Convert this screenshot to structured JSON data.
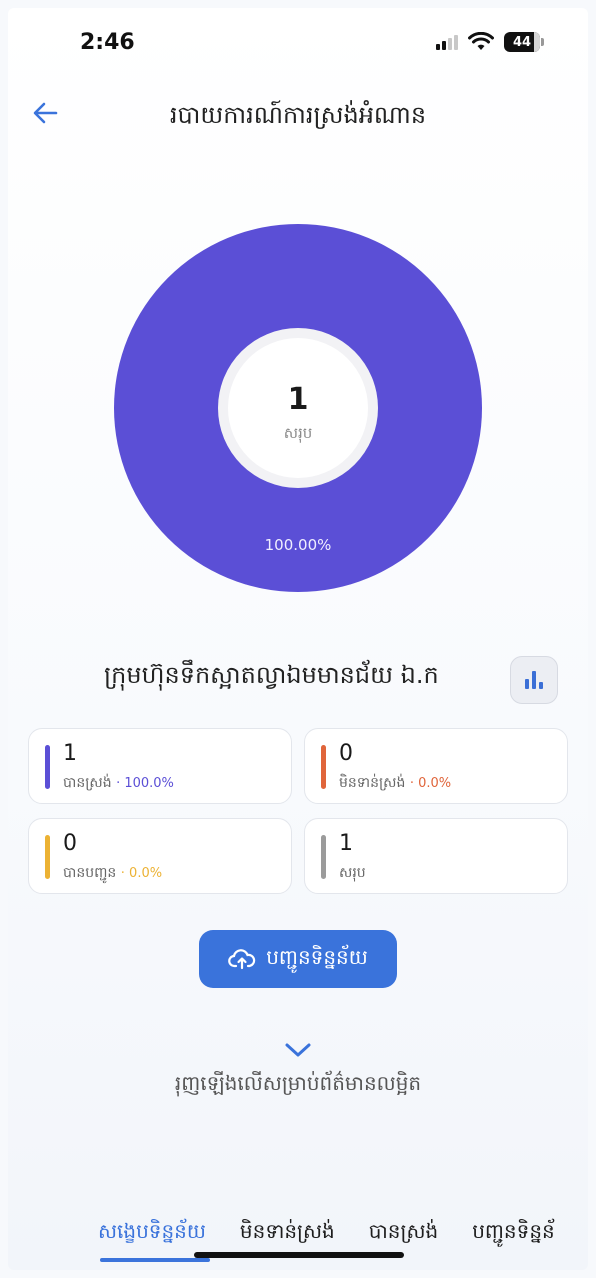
{
  "status": {
    "time": "2:46",
    "battery": "44"
  },
  "header": {
    "title": "របាយការណ៍ការស្រង់អំណាន"
  },
  "colors": {
    "accent": "#3a73db",
    "collected": "#5b4fd6",
    "pending": "#e0653b",
    "sent": "#ecb234",
    "total": "#9b9b9b"
  },
  "chart_data": {
    "type": "pie",
    "slices": [
      {
        "value": 100.0,
        "label": "100.00%",
        "color": "#5b4fd6"
      }
    ],
    "center_value": "1",
    "center_label": "សរុប"
  },
  "company": {
    "name": "ក្រុមហ៊ុនទឹកស្អាតល្វាឯមមានជ័យ ឯ.ក",
    "chart_button_icon": "bar-chart-icon"
  },
  "stats": [
    {
      "value": "1",
      "label": "បានស្រង់",
      "pct": "· 100.0%",
      "color": "#5b4fd6"
    },
    {
      "value": "0",
      "label": "មិនទាន់ស្រង់",
      "pct": "· 0.0%",
      "color": "#e0653b"
    },
    {
      "value": "0",
      "label": "បានបញ្ជូន",
      "pct": "· 0.0%",
      "color": "#ecb234"
    },
    {
      "value": "1",
      "label": "សរុប",
      "pct": "",
      "color": "#9b9b9b"
    }
  ],
  "actions": {
    "send_label": "បញ្ជូនទិន្នន័យ",
    "hint": "រុញឡើងលើសម្រាប់ព័ត៌មានលម្អិត"
  },
  "tabs": [
    {
      "label": "សង្ខេបទិន្នន័យ",
      "active": true
    },
    {
      "label": "មិនទាន់ស្រង់",
      "active": false
    },
    {
      "label": "បានស្រង់",
      "active": false
    },
    {
      "label": "បញ្ជូនទិន្នន័",
      "active": false
    }
  ]
}
